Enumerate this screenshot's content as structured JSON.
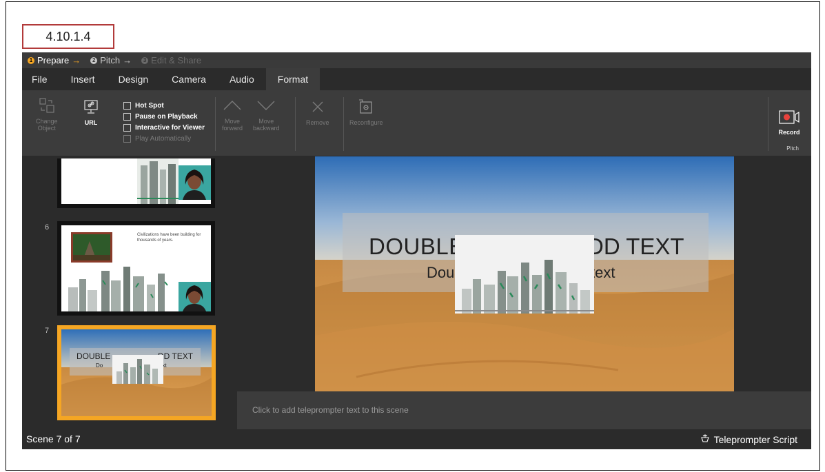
{
  "ref_label": "4.10.1.4",
  "steps": [
    {
      "num": "1",
      "label": "Prepare",
      "arrow": "→"
    },
    {
      "num": "2",
      "label": "Pitch",
      "arrow": "→"
    },
    {
      "num": "3",
      "label": "Edit & Share"
    }
  ],
  "menu": [
    "File",
    "Insert",
    "Design",
    "Camera",
    "Audio",
    "Format"
  ],
  "ribbon": {
    "change_object": [
      "Change",
      "Object"
    ],
    "url": "URL",
    "checkboxes": [
      "Hot Spot",
      "Pause on Playback",
      "Interactive for Viewer",
      "Play Automatically"
    ],
    "move_forward": [
      "Move",
      "forward"
    ],
    "move_backward": [
      "Move",
      "backward"
    ],
    "remove": "Remove",
    "reconfigure": "Reconfigure",
    "record": "Record",
    "pitch_group": "Pitch"
  },
  "scenes": {
    "numbers": [
      "6",
      "7"
    ],
    "scene6_text": "Civilizations have been building for thousands of years."
  },
  "slide": {
    "title_left": "DOUBLE",
    "title_right": "DD TEXT",
    "sub_left": "Dou",
    "sub_right": "text",
    "thumb_title_left": "DOUBLE",
    "thumb_title_right": "DD TEXT",
    "thumb_sub_left": "Do",
    "thumb_sub_right": "ext"
  },
  "prompter_placeholder": "Click to add teleprompter text to this scene",
  "status": {
    "scene_count": "Scene 7 of 7",
    "teleprompter": "Teleprompter Script"
  }
}
